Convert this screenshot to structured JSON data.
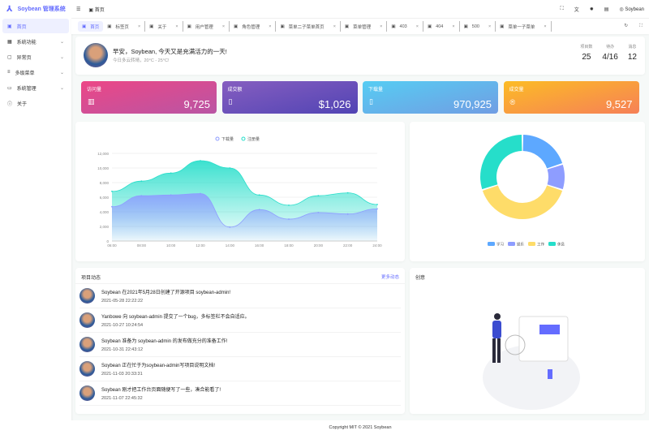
{
  "app": {
    "title": "Soybean 管理系统"
  },
  "sidebar": {
    "items": [
      {
        "label": "首页",
        "icon": "dashboard-icon",
        "active": true
      },
      {
        "label": "系统功能",
        "icon": "grid-icon"
      },
      {
        "label": "异常页",
        "icon": "error-page-icon"
      },
      {
        "label": "多级菜单",
        "icon": "menu-icon"
      },
      {
        "label": "系统管理",
        "icon": "system-icon"
      },
      {
        "label": "关于",
        "icon": "info-icon"
      }
    ]
  },
  "header": {
    "breadcrumb": "首页",
    "user": "Soybean"
  },
  "tabs": [
    {
      "label": "首页",
      "active": true
    },
    {
      "label": "标签页"
    },
    {
      "label": "关于"
    },
    {
      "label": "用户管理"
    },
    {
      "label": "角色管理"
    },
    {
      "label": "菜单二子菜单首页"
    },
    {
      "label": "菜单管理"
    },
    {
      "label": "403"
    },
    {
      "label": "404"
    },
    {
      "label": "500"
    },
    {
      "label": "菜单一子菜单"
    }
  ],
  "greeting": {
    "title": "早安，Soybean, 今天又是充满活力的一天!",
    "subtitle": "今日多云转晴，20°C - 25°C!",
    "stats": [
      {
        "label": "项目数",
        "value": "25"
      },
      {
        "label": "待办",
        "value": "4/16"
      },
      {
        "label": "消息",
        "value": "12"
      }
    ]
  },
  "stat_cards": [
    {
      "label": "访问量",
      "value": "9,725",
      "colors": [
        "#ec4786",
        "#b955a4"
      ]
    },
    {
      "label": "成交额",
      "value": "$1,026",
      "colors": [
        "#865ec0",
        "#5144b4"
      ]
    },
    {
      "label": "下载量",
      "value": "970,925",
      "colors": [
        "#56cdf3",
        "#719de3"
      ]
    },
    {
      "label": "成交量",
      "value": "9,527",
      "colors": [
        "#fcbc25",
        "#f68057"
      ]
    }
  ],
  "chart_data": [
    {
      "type": "area",
      "categories": [
        "06:00",
        "08:00",
        "10:00",
        "12:00",
        "14:00",
        "16:00",
        "18:00",
        "20:00",
        "22:00",
        "24:00"
      ],
      "ylim": [
        0,
        12000
      ],
      "yticks": [
        "0",
        "2,000",
        "4,000",
        "6,000",
        "8,000",
        "10,000",
        "12,000"
      ],
      "legend": "top",
      "series": [
        {
          "name": "下载量",
          "color": "#8e9dff",
          "values": [
            4700,
            6200,
            6300,
            6500,
            1900,
            4300,
            3000,
            3900,
            3700,
            4400
          ]
        },
        {
          "name": "注册量",
          "color": "#26deca",
          "values": [
            6800,
            8200,
            9300,
            11000,
            10000,
            6300,
            4900,
            6200,
            6600,
            5000
          ]
        }
      ]
    },
    {
      "type": "pie",
      "legend": "bottom",
      "series": [
        {
          "name": "学习",
          "value": 20,
          "color": "#5da8ff"
        },
        {
          "name": "娱乐",
          "value": 10,
          "color": "#8e9dff"
        },
        {
          "name": "工作",
          "value": 40,
          "color": "#fedc69"
        },
        {
          "name": "休息",
          "value": 30,
          "color": "#26deca"
        }
      ]
    }
  ],
  "activity": {
    "title": "项目动态",
    "more": "更多动态",
    "items": [
      {
        "msg": "Soybean 在2021年5月28日创建了开源项目 soybean-admin!",
        "time": "2021-05-28 22:22:22"
      },
      {
        "msg": "Yanbowe 向 soybean-admin 提交了一个bug，多标签栏不会自适应。",
        "time": "2021-10-27 10:24:54"
      },
      {
        "msg": "Soybean 准备为 soybean-admin 的发布做充分的准备工作!",
        "time": "2021-10-31 22:43:12"
      },
      {
        "msg": "Soybean 正在忙于为soybean-admin写项目说明文档!",
        "time": "2021-11-03 20:33:31"
      },
      {
        "msg": "Soybean 刚才把工作台页面随便写了一些，凑合能看了!",
        "time": "2021-11-07 22:45:32"
      }
    ]
  },
  "creative": {
    "title": "创意"
  },
  "footer": "Copyright MIT © 2021 Soybean"
}
